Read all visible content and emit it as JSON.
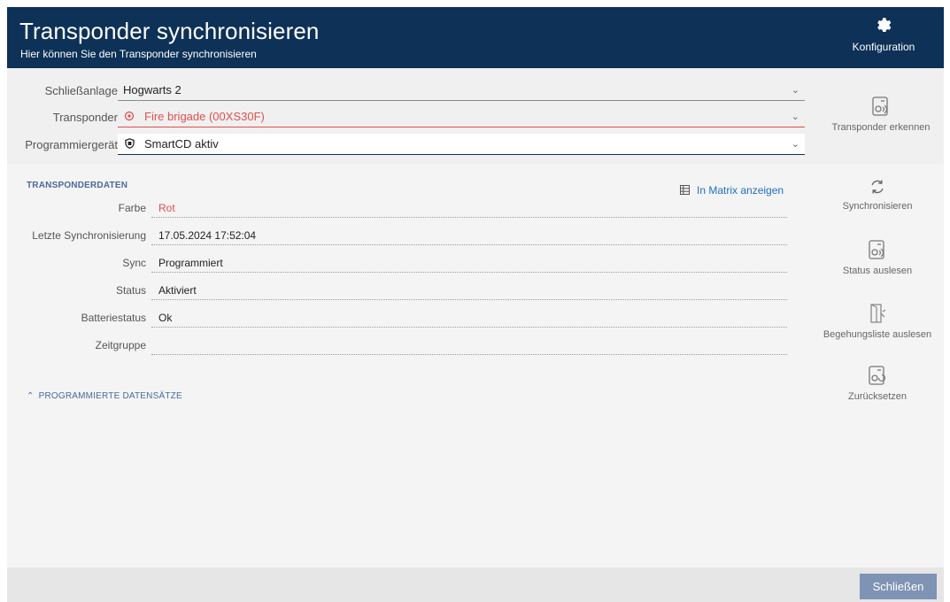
{
  "header": {
    "title": "Transponder synchronisieren",
    "subtitle": "Hier können Sie den Transponder synchronisieren",
    "config_label": "Konfiguration"
  },
  "form": {
    "schliessanlage_label": "Schließanlage",
    "schliessanlage_value": "Hogwarts 2",
    "transponder_label": "Transponder",
    "transponder_value": "Fire brigade (00XS30F)",
    "programmiergeraet_label": "Programmiergerät",
    "programmiergeraet_value": "SmartCD aktiv"
  },
  "side_actions": {
    "transponder_erkennen": "Transponder erkennen",
    "synchronisieren": "Synchronisieren",
    "status_auslesen": "Status auslesen",
    "begehungsliste": "Begehungsliste auslesen",
    "zuruecksetzen": "Zurücksetzen"
  },
  "transponder_data": {
    "section_title": "TRANSPONDERDATEN",
    "matrix_link": "In Matrix anzeigen",
    "rows": [
      {
        "label": "Farbe",
        "value": "Rot"
      },
      {
        "label": "Letzte Synchronisierung",
        "value": "17.05.2024 17:52:04"
      },
      {
        "label": "Sync",
        "value": "Programmiert"
      },
      {
        "label": "Status",
        "value": "Aktiviert"
      },
      {
        "label": "Batteriestatus",
        "value": "Ok"
      },
      {
        "label": "Zeitgruppe",
        "value": ""
      }
    ]
  },
  "programmed_records_label": "PROGRAMMIERTE DATENSÄTZE",
  "footer": {
    "close_label": "Schließen"
  },
  "colors": {
    "header_bg": "#0d3157",
    "accent_red": "#e05050",
    "link_blue": "#1f6fc1",
    "close_button": "#7f93b4"
  },
  "icons": {
    "config": "gear-icon",
    "transponder": "transponder-icon",
    "programmer": "shield-device-icon",
    "matrix": "grid-icon",
    "sync": "sync-arrows-icon",
    "chevron": "chevron-down-icon",
    "collapse": "chevron-up-icon"
  }
}
